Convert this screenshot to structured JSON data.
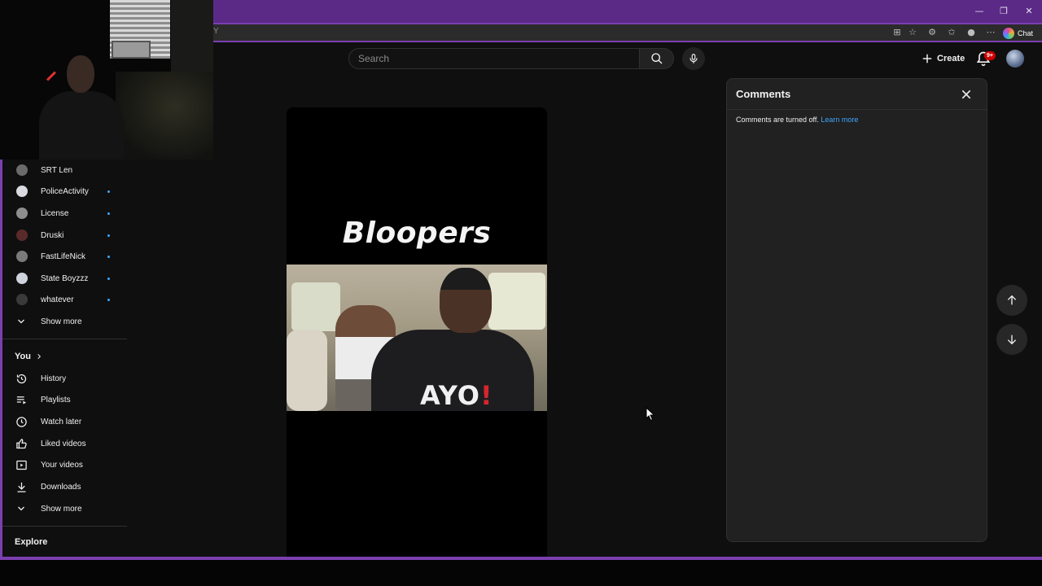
{
  "browser": {
    "address_fragment": "Y",
    "window_controls": {
      "minimize": "—",
      "restore": "❐",
      "close": "✕"
    },
    "chat_label": "Chat"
  },
  "header": {
    "search_placeholder": "Search",
    "create_label": "Create",
    "notification_badge": "9+"
  },
  "sidebar": {
    "subscriptions": [
      {
        "label": "SRT Len",
        "live": false,
        "avatar_color": "#6b6b6b"
      },
      {
        "label": "PoliceActivity",
        "live": true,
        "avatar_color": "#d9dbe0"
      },
      {
        "label": "License",
        "live": true,
        "avatar_color": "#8e8e8e"
      },
      {
        "label": "Druski",
        "live": true,
        "avatar_color": "#5a2a2a"
      },
      {
        "label": "FastLifeNick",
        "live": true,
        "avatar_color": "#7a7a7a"
      },
      {
        "label": "State Boyzzz",
        "live": true,
        "avatar_color": "#cfd3dc"
      },
      {
        "label": "whatever",
        "live": true,
        "avatar_color": "#3a3a3a"
      }
    ],
    "show_more_subs": "Show more",
    "you_section": "You",
    "you_items": [
      {
        "label": "History",
        "icon": "history-icon"
      },
      {
        "label": "Playlists",
        "icon": "playlists-icon"
      },
      {
        "label": "Watch later",
        "icon": "watch-later-icon"
      },
      {
        "label": "Liked videos",
        "icon": "thumbs-up-icon"
      },
      {
        "label": "Your videos",
        "icon": "your-videos-icon"
      },
      {
        "label": "Downloads",
        "icon": "download-icon"
      }
    ],
    "show_more_you": "Show more",
    "explore_section": "Explore"
  },
  "short": {
    "title_overlay": "Bloopers",
    "shirt_text": "AYO",
    "shirt_mark": "!"
  },
  "comments": {
    "title": "Comments",
    "message": "Comments are turned off.",
    "learn_more": "Learn more"
  },
  "colors": {
    "frame_accent": "#7b3fb0",
    "titlebar": "#5b2a86",
    "link": "#3ea6ff",
    "badge": "#cc0000"
  }
}
